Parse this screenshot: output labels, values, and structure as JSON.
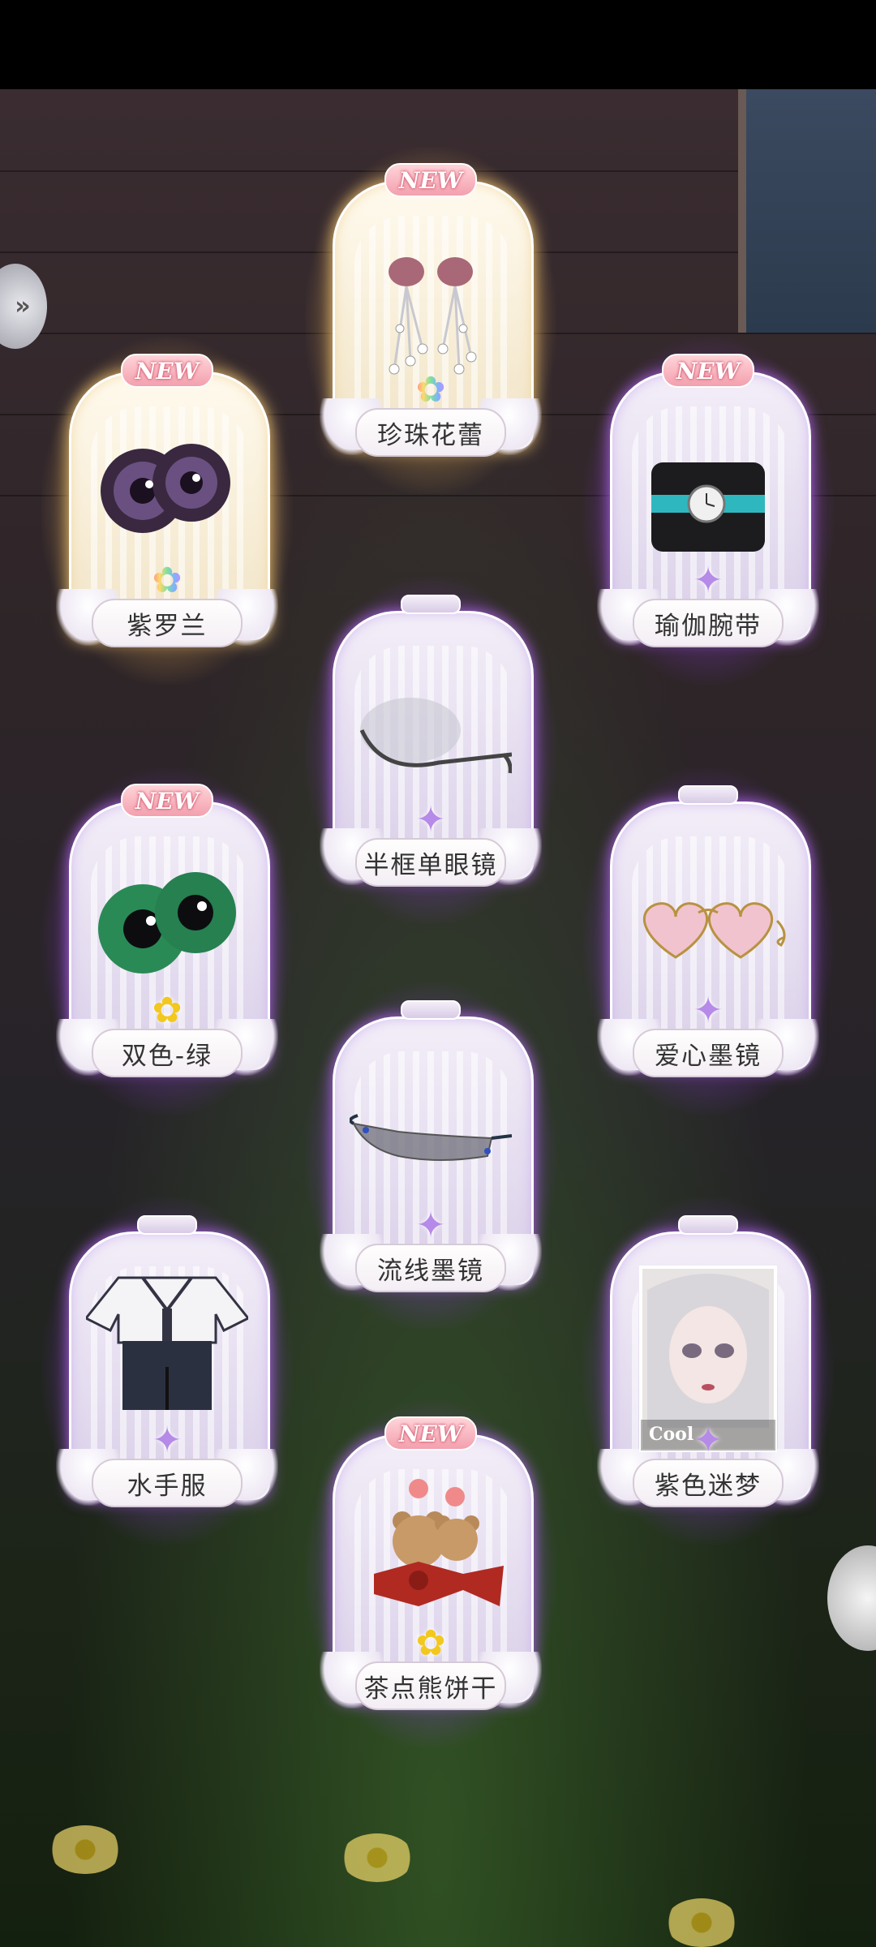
{
  "colors": {
    "purple_glow": "#aa50ff",
    "gold_glow": "#ffdc82",
    "badge": "#f3a0ae",
    "label_text": "#333333"
  },
  "cards": [
    {
      "id": "pearl-bud",
      "name": "珍珠花蕾",
      "badge": "NEW",
      "rarity": "gold",
      "gem": "rainbow",
      "item_icon": "pearl-earring-icon"
    },
    {
      "id": "violet",
      "name": "紫罗兰",
      "badge": "NEW",
      "rarity": "gold",
      "gem": "rainbow",
      "item_icon": "violet-eyes-icon"
    },
    {
      "id": "yoga-wristband",
      "name": "瑜伽腕带",
      "badge": "NEW",
      "rarity": "purple",
      "gem": "purple",
      "item_icon": "wristband-icon"
    },
    {
      "id": "half-frame-monocle",
      "name": "半框单眼镜",
      "badge": "",
      "rarity": "purple",
      "gem": "purple",
      "item_icon": "monocle-icon"
    },
    {
      "id": "dual-green",
      "name": "双色-绿",
      "badge": "NEW",
      "rarity": "purple",
      "gem": "yellow",
      "item_icon": "green-eyes-icon"
    },
    {
      "id": "heart-sunglasses",
      "name": "爱心墨镜",
      "badge": "",
      "rarity": "purple",
      "gem": "purple",
      "item_icon": "heart-sunglasses-icon"
    },
    {
      "id": "streamline-sunglasses",
      "name": "流线墨镜",
      "badge": "",
      "rarity": "purple",
      "gem": "purple",
      "item_icon": "streamline-sunglasses-icon"
    },
    {
      "id": "sailor-suit",
      "name": "水手服",
      "badge": "",
      "rarity": "purple",
      "gem": "purple",
      "item_icon": "sailor-suit-icon"
    },
    {
      "id": "purple-dream",
      "name": "紫色迷梦",
      "badge": "",
      "rarity": "purple",
      "gem": "purple",
      "item_icon": "portrait-icon",
      "portrait_caption": "Cool"
    },
    {
      "id": "tea-bear-cookie",
      "name": "茶点熊饼干",
      "badge": "NEW",
      "rarity": "purple",
      "gem": "yellow",
      "item_icon": "bear-earring-icon"
    }
  ]
}
